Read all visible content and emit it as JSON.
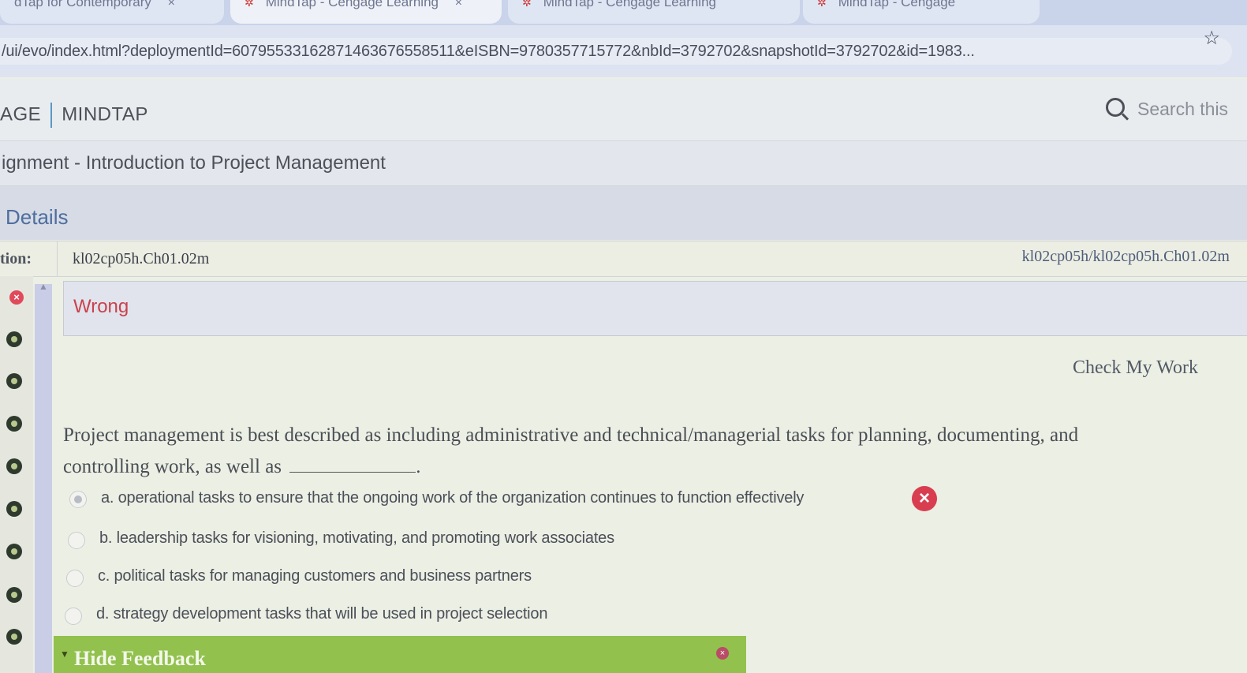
{
  "browser": {
    "tabs": [
      {
        "label": "dTap for Contemporary",
        "close": "×"
      },
      {
        "label": "MindTap - Cengage Learning",
        "close": "×"
      },
      {
        "label": "MindTap - Cengage Learning"
      },
      {
        "label": "MindTap - Cengage"
      }
    ],
    "url": "/ui/evo/index.html?deploymentId=60795533162871463676558511&eISBN=9780357715772&nbId=3792702&snapshotId=3792702&id=1983...",
    "star_icon": "star-icon"
  },
  "header": {
    "brand_left": "AGE",
    "brand_right": "MINDTAP",
    "search_placeholder": "Search this",
    "search_icon": "search-icon"
  },
  "assignment": {
    "title": "ignment - Introduction to Project Management"
  },
  "details": {
    "heading": "Details",
    "question_label": "tion:",
    "question_id": "kl02cp05h.Ch01.02m",
    "question_path": "kl02cp05h/kl02cp05h.Ch01.02m"
  },
  "question_list": {
    "statuses": [
      "wrong",
      "correct",
      "correct",
      "correct",
      "correct",
      "correct",
      "correct",
      "correct",
      "correct"
    ]
  },
  "result": {
    "status": "Wrong",
    "check_work": "Check My Work"
  },
  "question": {
    "text_line1": "Project management is best described as including administrative and technical/managerial tasks for planning, documenting, and",
    "text_line2": "controlling work, as well as",
    "text_end": ".",
    "options": [
      {
        "label": "a. operational tasks to ensure that the ongoing work of the organization continues to function effectively",
        "selected": true,
        "result": "incorrect"
      },
      {
        "label": "b. leadership tasks for visioning, motivating, and promoting work associates",
        "selected": false
      },
      {
        "label": "c. political tasks for managing customers and business partners",
        "selected": false
      },
      {
        "label": "d. strategy development tasks that will be used in project selection",
        "selected": false
      }
    ]
  },
  "feedback": {
    "label": "Hide Feedback"
  },
  "colors": {
    "wrong": "#c9424d",
    "feedback_bar": "#92c14e",
    "details_blue": "#4e6e9d"
  }
}
